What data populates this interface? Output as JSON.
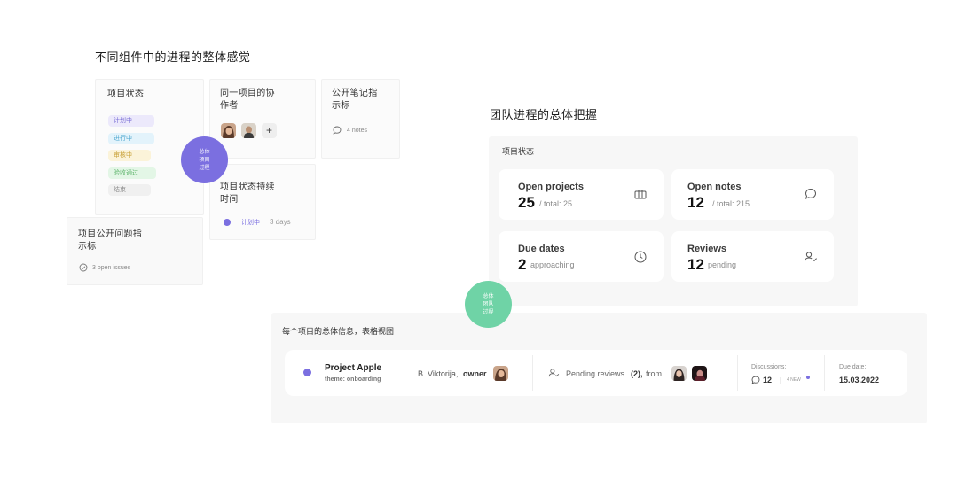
{
  "section_left": {
    "heading": "不同组件中的进程的整体感觉"
  },
  "status_card": {
    "title": "项目状态",
    "tags": [
      {
        "label": "计划中",
        "bg": "#ece9fb",
        "fg": "#7a6fd6"
      },
      {
        "label": "进行中",
        "bg": "#e3f3fb",
        "fg": "#4ea7cf"
      },
      {
        "label": "审核中",
        "bg": "#fbf3d9",
        "fg": "#c9a23a"
      },
      {
        "label": "验收通过",
        "bg": "#e3f6e6",
        "fg": "#5cb36a"
      },
      {
        "label": "结束",
        "bg": "#f0f0f0",
        "fg": "#8a8a8a"
      }
    ]
  },
  "collab_card": {
    "title_line1": "同一项目的协",
    "title_line2": "作者",
    "add_label": "+"
  },
  "notes_card": {
    "title_line1": "公开笔记指",
    "title_line2": "示标",
    "count": "4 notes"
  },
  "duration_card": {
    "title_line1": "项目状态持续",
    "title_line2": "时间",
    "status": "计划中",
    "duration": "3 days"
  },
  "issues_card": {
    "title_line1": "项目公开问题指",
    "title_line2": "示标",
    "count": "3 open issues"
  },
  "purple_bubble": {
    "line1": "总体",
    "line2": "项目",
    "line3": "过程",
    "color": "#7b6fe0"
  },
  "section_right": {
    "heading": "团队进程的总体把握"
  },
  "stats_panel": {
    "title": "项目状态",
    "open_projects": {
      "label": "Open projects",
      "value": "25",
      "sub": "/ total: 25",
      "icon": "briefcase-icon"
    },
    "open_notes": {
      "label": "Open notes",
      "value": "12",
      "sub": "/ total: 215",
      "icon": "chat-bubble-icon"
    },
    "due_dates": {
      "label": "Due dates",
      "value": "2",
      "sub": "approaching",
      "icon": "clock-icon"
    },
    "reviews": {
      "label": "Reviews",
      "value": "12",
      "sub": "pending",
      "icon": "user-check-icon"
    }
  },
  "green_bubble": {
    "line1": "总体",
    "line2": "团队",
    "line3": "过程",
    "color": "#6fd3a6"
  },
  "table_section": {
    "title": "每个项目的总体信息，表格视图",
    "row": {
      "project_name": "Project Apple",
      "theme": "theme: onboarding",
      "owner_name": "B. Viktorija,",
      "owner_role": "owner",
      "pending_text": "Pending reviews",
      "pending_count": "(2),",
      "pending_from": "from",
      "discussions_label": "Discussions:",
      "discussions_count": "12",
      "new_label": "4 NEW",
      "due_label": "Due date:",
      "due_value": "15.03.2022"
    }
  }
}
